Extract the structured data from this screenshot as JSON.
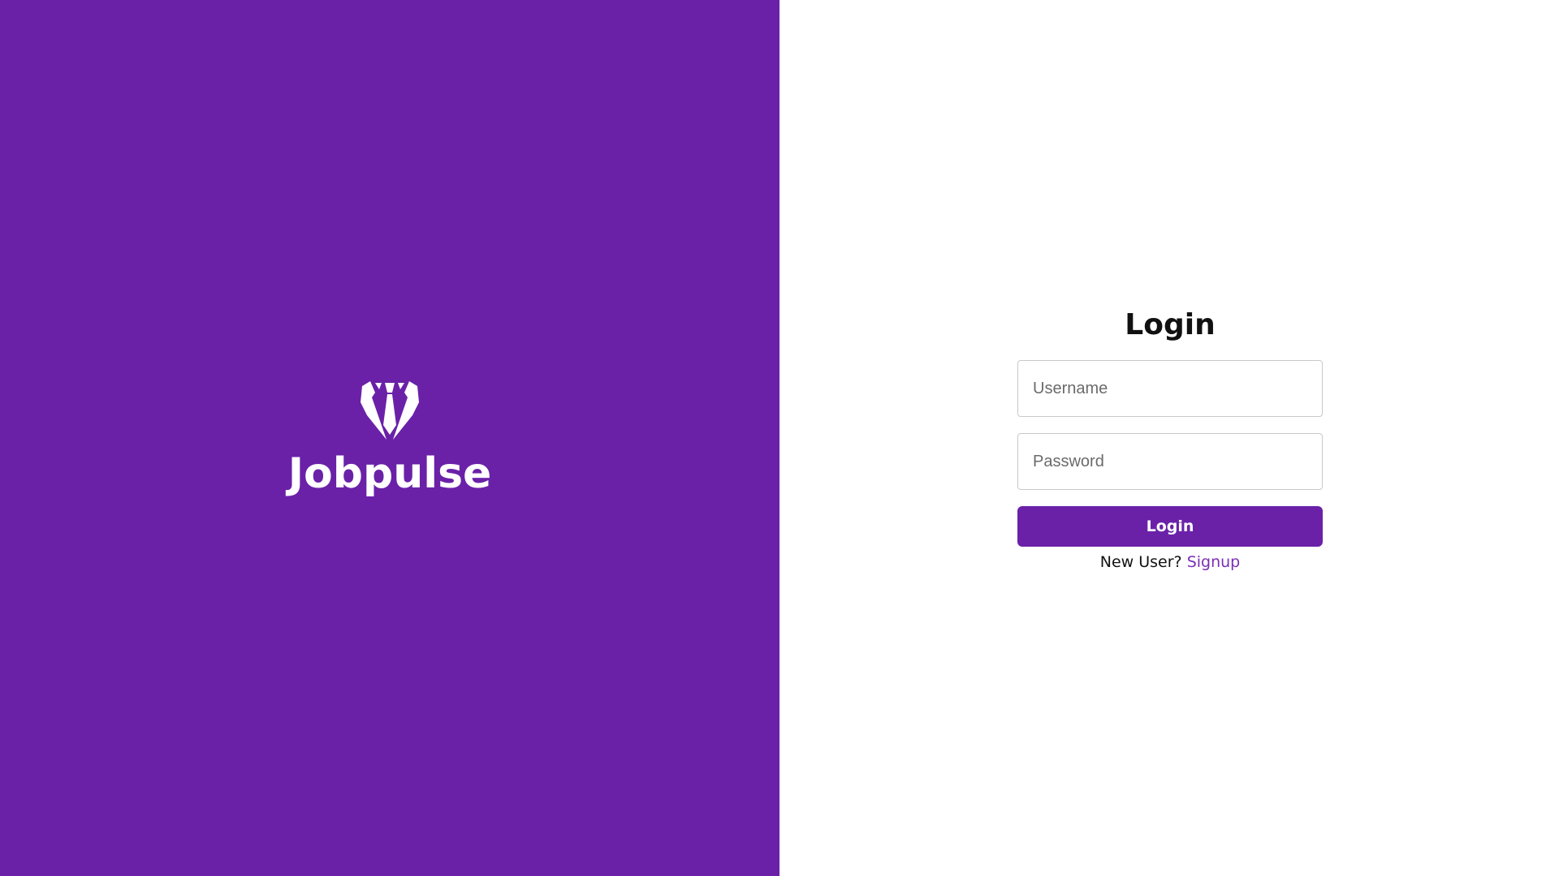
{
  "brand": {
    "name": "Jobpulse",
    "icon": "tuxedo-icon",
    "background_color": "#6a21a8"
  },
  "login": {
    "title": "Login",
    "username": {
      "value": "",
      "placeholder": "Username"
    },
    "password": {
      "value": "",
      "placeholder": "Password"
    },
    "submit_label": "Login",
    "new_user_text": "New User?",
    "signup_label": "Signup",
    "button_color": "#6a21a8",
    "link_color": "#7a2fb5"
  }
}
